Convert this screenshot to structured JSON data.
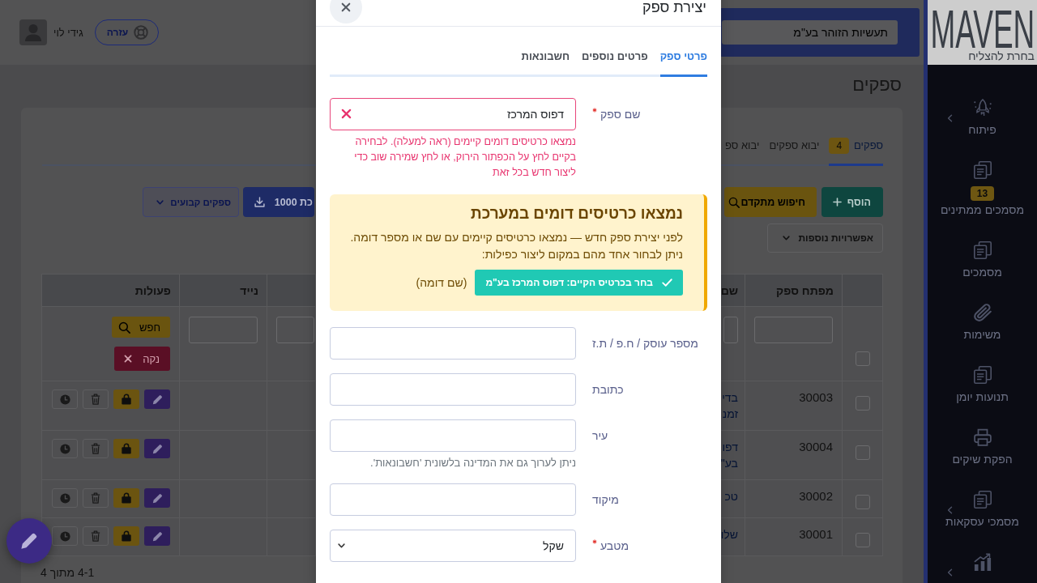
{
  "sidebar": {
    "logo": {
      "text": "MAVEN",
      "tagline": "בחרת להצליח"
    },
    "items": [
      {
        "label": "פיתוח",
        "has_submenu": true
      },
      {
        "label": "מסמכים ממתינים",
        "badge": "13",
        "has_submenu": false
      },
      {
        "label": "מסמכים",
        "has_submenu": false
      },
      {
        "label": "משימות",
        "has_submenu": false
      },
      {
        "label": "תנועות יומן",
        "has_submenu": false
      },
      {
        "label": "הפקת שיקים",
        "has_submenu": false
      },
      {
        "label": "מסמכי עסקאות",
        "has_submenu": true
      },
      {
        "has_submenu": true
      }
    ]
  },
  "header": {
    "company_search": {
      "value": "תעשיות הזוהר בע\"מ"
    },
    "help_button": "עזרה",
    "user_name": "גידי לוי"
  },
  "page": {
    "title": "ספקים",
    "tabs": [
      {
        "label": "ספקים",
        "badge": "4",
        "selected": true
      },
      {
        "label": "יבוא ספקים",
        "selected": false
      },
      {
        "label": "יבוא ספ",
        "selected": false
      }
    ],
    "toolbar": {
      "start": [
        {
          "kind": "add",
          "label": "הוסף"
        },
        {
          "kind": "search",
          "label": "חיפוש מתקדם"
        }
      ],
      "end": [
        {
          "kind": "export",
          "label": "כת 1000"
        },
        {
          "kind": "menu",
          "label": "ספקים קבועים"
        }
      ],
      "more": [
        {
          "kind": "outline",
          "label": "אפשרויות נוספות"
        }
      ]
    },
    "table": {
      "columns": [
        {
          "kind": "select"
        },
        {
          "kind": "key",
          "label": "מפתח ספק"
        },
        {
          "kind": "name",
          "label": "שם"
        },
        {
          "kind": "other"
        },
        {
          "kind": "other",
          "label": "נייד"
        },
        {
          "kind": "actions",
          "label": "פעולות"
        }
      ],
      "all_selected": false,
      "filter_row": {
        "search_button": "חפש",
        "clear_button": "נקה"
      },
      "rows": [
        {
          "selected": false,
          "key": "30003",
          "name": "בדי זמנ"
        },
        {
          "selected": false,
          "key": "30004",
          "name": "דפו בע\""
        },
        {
          "selected": false,
          "key": "30002",
          "name": "טכ"
        },
        {
          "selected": false,
          "key": "30001",
          "name": "שלו"
        }
      ]
    },
    "pagination": "4-1 מתוך 4"
  },
  "dialog": {
    "title": "יצירת ספק",
    "tabs": [
      {
        "label": "פרטי ספק",
        "selected": true
      },
      {
        "label": "פרטים נוספים",
        "selected": false
      },
      {
        "label": "חשבונאות",
        "selected": false
      }
    ],
    "name_field": {
      "label": "שם ספק",
      "required": true,
      "kind": "text",
      "value": "דפוס המרכז",
      "invalid": true,
      "clearable": true,
      "error": "נמצאו כרטיסים דומים קיימים (ראה למעלה). לבחירה בקיים לחץ על הכפתור הירוק, או לחץ שמירה שוב כדי ליצור חדש בכל זאת"
    },
    "duplicate_warning": {
      "title": "נמצאו כרטיסים דומים במערכת",
      "lines": [
        "לפני יצירת ספק חדש — נמצאו כרטיסים קיימים עם שם או מספר דומה.",
        "ניתן לבחור אחד מהם במקום ליצור כפילות:"
      ],
      "choose_button": "בחר בכרטיס הקיים: דפוס המרכז בע\"מ",
      "note": "(שם דומה)"
    },
    "fields": [
      {
        "label": "מספר עוסק / ח.פ / ת.ז",
        "required": false,
        "kind": "text"
      },
      {
        "label": "כתובת",
        "required": false,
        "kind": "text"
      },
      {
        "label": "עיר",
        "required": false,
        "kind": "text",
        "help": "ניתן לערוך גם את המדינה בלשונית 'חשבונאות'."
      },
      {
        "label": "מיקוד",
        "required": false,
        "kind": "text"
      },
      {
        "label": "מטבע",
        "required": true,
        "kind": "select",
        "value": "שקל"
      }
    ]
  }
}
